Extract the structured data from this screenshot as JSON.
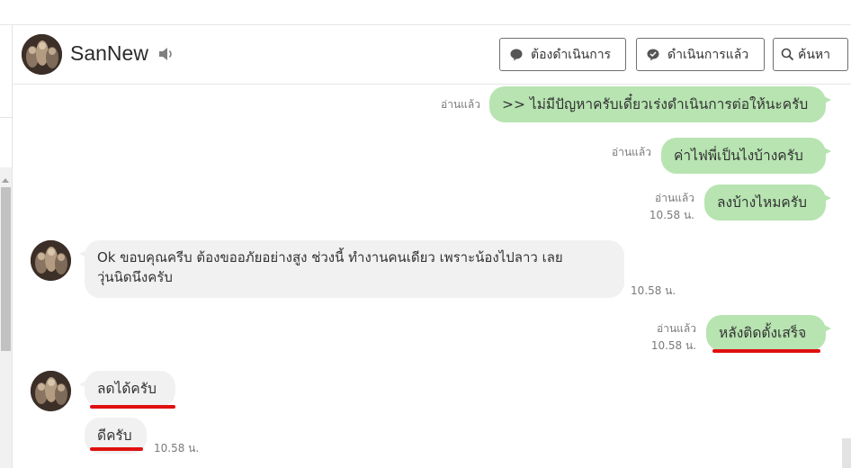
{
  "contact": {
    "name": "SanNew"
  },
  "header_buttons": {
    "todo": "ต้องดำเนินการ",
    "done": "ดำเนินการแล้ว",
    "search": "ค้นหา"
  },
  "messages": [
    {
      "from": "me",
      "text": ">> ไม่มีปัญหาครับเดี๋ยวเร่งดำเนินการต่อให้นะครับ",
      "read": "อ่านแล้ว"
    },
    {
      "from": "me",
      "text": "ค่าไฟพี่เป็นไงบ้างครับ",
      "read": "อ่านแล้ว"
    },
    {
      "from": "me",
      "text": "ลงบ้างไหมครับ",
      "read": "อ่านแล้ว",
      "time": "10.58 น."
    },
    {
      "from": "them",
      "line1": "Ok ขอบคุณครีบ ต้องขออภัยอย่างสูง ช่วงนี้ ทำงานคนเดียว เพราะน้องไปลาว เลย",
      "line2": "วุ่นนิดนึงครับ",
      "time": "10.58 น."
    },
    {
      "from": "me",
      "text": "หลังติดตั้งเสร็จ",
      "read": "อ่านแล้ว",
      "time": "10.58 น."
    },
    {
      "from": "them",
      "text": "ลดได้ครับ"
    },
    {
      "from": "them",
      "text": "ดีครับ",
      "time": "10.58 น."
    }
  ],
  "colors": {
    "my_bubble": "#b7e4b1",
    "their_bubble": "#f1f1f2",
    "highlight_underline": "#e01010"
  },
  "icons": {
    "speaker": "speaker-icon",
    "todo": "speech-bubble-icon",
    "done": "check-bubble-icon",
    "search": "search-icon"
  }
}
